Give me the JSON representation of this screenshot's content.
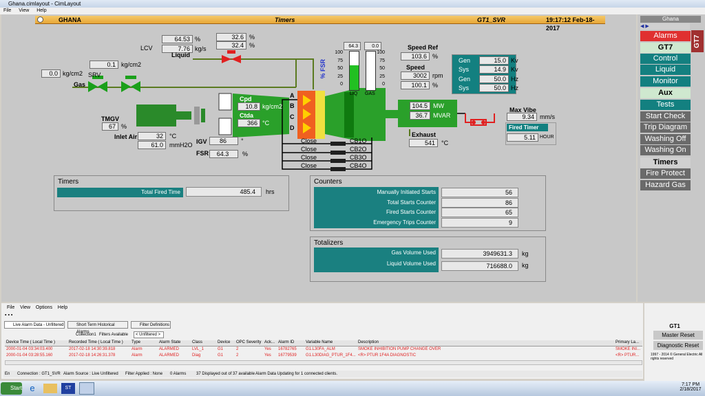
{
  "window": {
    "title": "Ghana.cimlayout - CimLayout",
    "menu": [
      "File",
      "View",
      "Help"
    ]
  },
  "header": {
    "site": "GHANA",
    "screen": "Timers",
    "unit": "GT1_SVR",
    "time": "19:17:12 Feb-18-2017"
  },
  "diagram": {
    "liquid_label": "Liquid",
    "lcv_label": "LCV",
    "lcv_pct": "64.53",
    "lcv_pct_unit": "%",
    "lcv_kgs": "7.76",
    "lcv_kgs_unit": "kg/s",
    "liq_v1": "32.6",
    "liq_v1_unit": "%",
    "liq_v2": "32.4",
    "liq_v2_unit": "%",
    "srv_label": "SRV",
    "srv_val": "0.1",
    "srv_unit": "kg/cm2",
    "gas_p": "0.0",
    "gas_p_unit": "kg/cm2",
    "gas_label": "Gas",
    "tmgv_label": "TMGV",
    "tmgv_val": "67",
    "tmgv_unit": "%",
    "inlet_label": "Inlet Air",
    "inlet_temp": "32",
    "inlet_temp_unit": "°C",
    "inlet_press": "61.0",
    "inlet_press_unit": "mmH2O",
    "igv_label": "IGV",
    "igv_val": "86",
    "igv_unit": "°",
    "fsr_label": "FSR",
    "fsr_val": "64.3",
    "fsr_unit": "%",
    "cpd_label": "Cpd",
    "cpd_val": "10.8",
    "cpd_unit": "kg/cm2",
    "ctda_label": "Ctda",
    "ctda_val": "366",
    "ctda_unit": "°C",
    "chambers": [
      "A",
      "B",
      "C",
      "D"
    ],
    "fsr_bar_label": "% FSR",
    "liq_bar_val": "64.3",
    "gas_bar_val": "0.0",
    "liq_bar_label": "LIQ",
    "gas_bar_label": "GAS",
    "ticks": [
      "100",
      "75",
      "50",
      "25",
      "0"
    ],
    "liq_bar_level": 0.643,
    "gas_bar_level": 0.0,
    "speed_ref_label": "Speed Ref",
    "speed_ref_val": "103.6",
    "speed_ref_unit": "%",
    "speed_label": "Speed",
    "speed_rpm": "3002",
    "speed_rpm_unit": "rpm",
    "speed_pct": "100.1",
    "speed_pct_unit": "%",
    "gen_rows": [
      {
        "label": "Gen",
        "val": "15.0",
        "unit": "Kv"
      },
      {
        "label": "Sys",
        "val": "14.9",
        "unit": "Kv"
      },
      {
        "label": "Gen",
        "val": "50.0",
        "unit": "Hz"
      },
      {
        "label": "Sys",
        "val": "50.0",
        "unit": "Hz"
      }
    ],
    "mw_val": "104.5",
    "mw_unit": "MW",
    "mvar_val": "36.7",
    "mvar_unit": "MVAR",
    "maxvibe_label": "Max Vibe",
    "maxvibe_val": "9.34",
    "maxvibe_unit": "mm/s",
    "fired_timer_label": "Fired Timer",
    "fired_timer_val": "5.11",
    "fired_timer_unit": "HOUR",
    "exhaust_label": "Exhaust",
    "exhaust_val": "541",
    "exhaust_unit": "°C",
    "breakers": [
      {
        "state": "Close",
        "name": "CB1O"
      },
      {
        "state": "Close",
        "name": "CB2O"
      },
      {
        "state": "Close",
        "name": "CB3O"
      },
      {
        "state": "Close",
        "name": "CB4O"
      }
    ]
  },
  "timers": {
    "title": "Timers",
    "label": "Total Fired Time",
    "value": "485.4",
    "unit": "hrs"
  },
  "counters": {
    "title": "Counters",
    "rows": [
      {
        "label": "Manually Initiated Starts",
        "value": "56"
      },
      {
        "label": "Total Starts Counter",
        "value": "86"
      },
      {
        "label": "Fired Starts Counter",
        "value": "65"
      },
      {
        "label": "Emergency Trips Counter",
        "value": "9"
      }
    ]
  },
  "totalizers": {
    "title": "Totalizers",
    "rows": [
      {
        "label": "Gas Volume Used",
        "value": "3949631.3",
        "unit": "kg"
      },
      {
        "label": "Liquid Volume Used",
        "value": "716688.0",
        "unit": "kg"
      }
    ]
  },
  "nav": {
    "site": "Ghana",
    "unit": "GT7",
    "items": [
      "Alarms",
      "GT7",
      "Control",
      "Liquid",
      "Monitor",
      "Aux",
      "Tests",
      "Start Check",
      "Trip Diagram",
      "Washing Off",
      "Washing On",
      "Timers",
      "Fire Protect",
      "Hazard Gas"
    ]
  },
  "alarms": {
    "menu": [
      "File",
      "View",
      "Options",
      "Help"
    ],
    "tabs": [
      "Live Alarm Data - Unfiltered",
      "Short Term Historical Alarms",
      "Filter Definitions"
    ],
    "collection": "Collection1",
    "filters_label": "Filters Available",
    "filter_value": "< Unfiltered >",
    "columns": [
      "Device Time ( Local Time )",
      "Recorded Time ( Local Time )",
      "Type",
      "Alarm State",
      "Class",
      "Device",
      "OPC Severity",
      "Ack...",
      "Alarm ID",
      "Variable Name",
      "Description",
      "Primary La..."
    ],
    "rows": [
      [
        "2000-01-04 03:34:03.400",
        "2017-02-18 14:30:39.818",
        "Alarm",
        "ALARMED",
        "LVL_1",
        "G1",
        "2",
        "Yes",
        "16782765",
        "G1.L30FA_ALM",
        "SMOKE INHIBITION PUMP CHANGE OVER",
        "SMOKE INI..."
      ],
      [
        "2000-01-04 03:28:55.160",
        "2017-02-18 14:26:31.378",
        "Alarm",
        "ALARMED",
        "Diag",
        "G1",
        "2",
        "Yes",
        "16779539",
        "G1.L30DIAG_PTUR_1F4...",
        "<R> PTUR 1F4A DIAGNOSTIC",
        "<R> PTUR..."
      ]
    ],
    "status": [
      "En",
      "Connection : GT1_SVR",
      "Alarm Source : Live Unfiltered",
      "Filter Applied : None",
      "0 Alarms",
      "37 Displayed out of 37 available",
      "Alarm Data Updating for 1 connected clients."
    ]
  },
  "reset": {
    "title": "GT1",
    "master": "Master Reset",
    "diagnostic": "Diagnostic Reset",
    "copyright": "1997 - 2014 © General Electric All rights reserved"
  },
  "taskbar": {
    "start": "Start",
    "time": "7:17 PM",
    "date": "2/18/2017"
  }
}
